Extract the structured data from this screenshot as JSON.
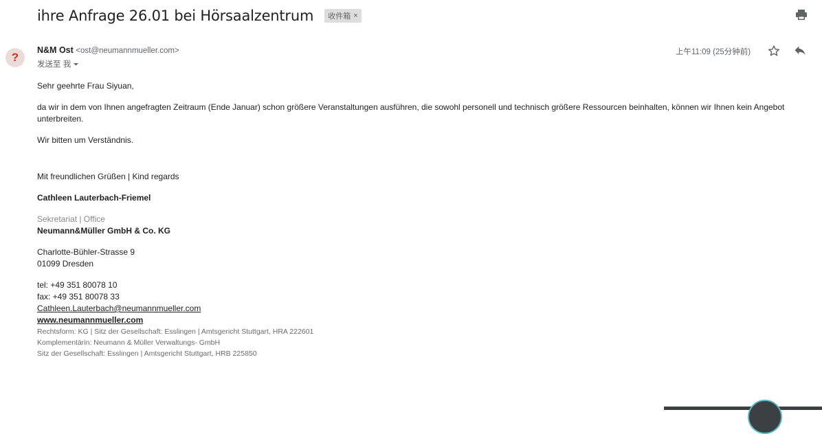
{
  "email": {
    "subject": "ihre Anfrage 26.01 bei Hörsaalzentrum",
    "label": "收件箱",
    "label_close": "×",
    "avatar_letter": "?",
    "sender_name": "N&M Ost",
    "sender_email": "<ost@neumannmueller.com>",
    "recipient": "发送至 我",
    "timestamp": "上午11:09 (25分钟前)"
  },
  "icons": {
    "print": "printer-icon",
    "star": "star-outline-icon",
    "reply": "reply-icon",
    "caret": "caret-down-icon"
  },
  "body": {
    "greeting": "Sehr geehrte Frau Siyuan,",
    "paragraph1": "da wir in dem von Ihnen angefragten  Zeitraum (Ende Januar) schon größere Veranstaltungen ausführen, die sowohl personell und technisch größere Ressourcen beinhalten, können wir Ihnen kein Angebot unterbreiten.",
    "paragraph2": "Wir bitten um Verständnis.",
    "closing": "Mit freundlichen Grüßen | Kind regards"
  },
  "signature": {
    "name": "Cathleen Lauterbach-Friemel",
    "role": "Sekretariat | Office",
    "company": "Neumann&Müller GmbH & Co. KG",
    "street": "Charlotte-Bühler-Strasse 9",
    "city": "01099 Dresden",
    "tel": "tel: +49 351 80078 10",
    "fax": "fax: +49 351 80078 33",
    "email_link": "Cathleen.Lauterbach@neumannmueller.com",
    "website_link": "www.neumannmueller.com",
    "legal1": "Rechtsform: KG | Sitz der Gesellschaft: Esslingen | Amtsgericht Stuttgart, HRA 222601",
    "legal2": "Komplementärin: Neumann & Müller Verwaltungs- GmbH",
    "legal3": "Sitz der Gesellschaft: Esslingen | Amtsgericht Stuttgart, HRB 225850"
  },
  "colors": {
    "avatar_bg": "#eadcd8",
    "avatar_fg": "#d93025",
    "label_bg": "#dddddd"
  }
}
